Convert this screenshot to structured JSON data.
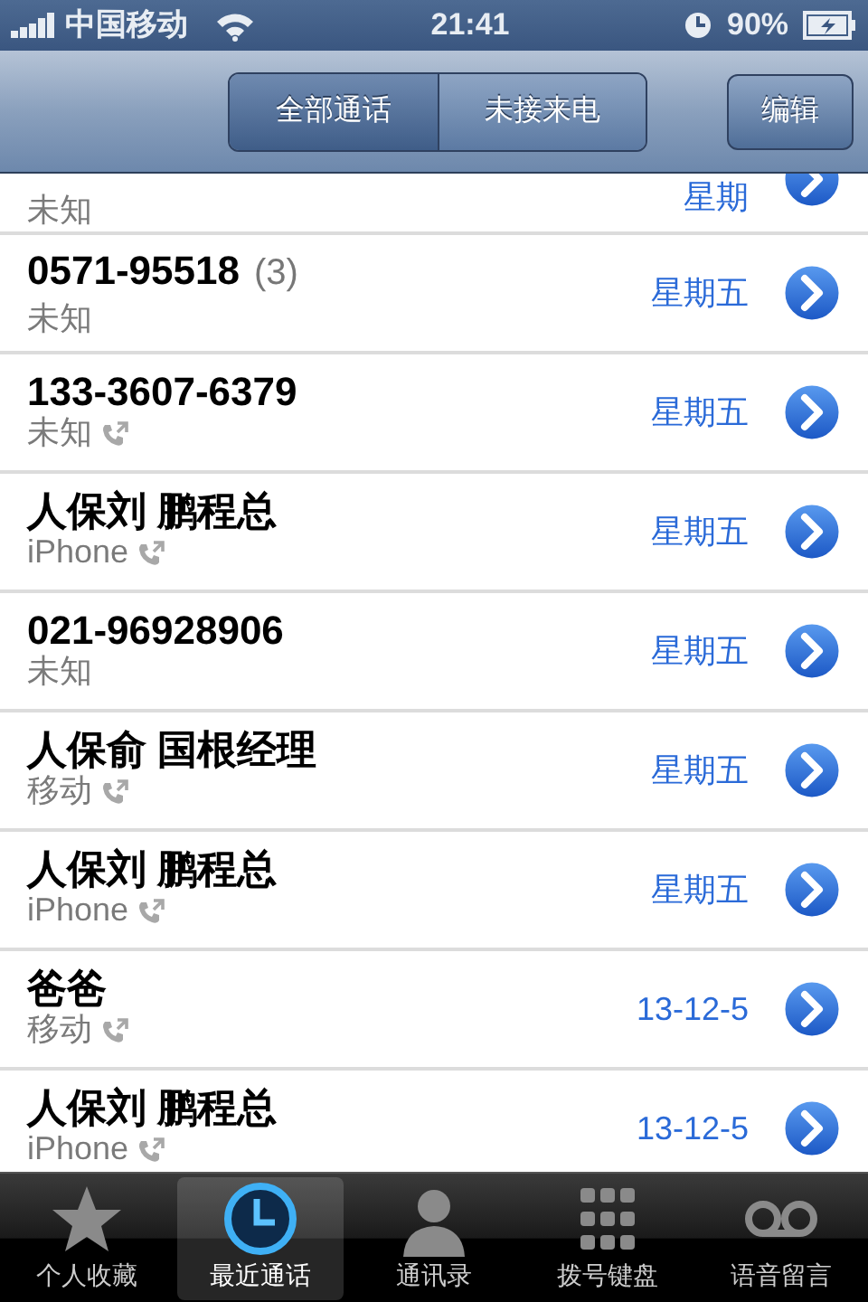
{
  "status_bar": {
    "carrier": "中国移动",
    "time": "21:41",
    "battery": "90%"
  },
  "nav_bar": {
    "segments": [
      {
        "label": "全部通话",
        "selected": true
      },
      {
        "label": "未接来电",
        "selected": false
      }
    ],
    "edit_button": "编辑"
  },
  "calls": [
    {
      "kind": "partial",
      "subtitle": "未知",
      "outgoing": false,
      "date": "星期"
    },
    {
      "kind": "full",
      "name": "0571-95518",
      "count": "(3)",
      "subtitle": "未知",
      "outgoing": false,
      "date": "星期五"
    },
    {
      "kind": "full",
      "name": "133-3607-6379",
      "subtitle": "未知",
      "outgoing": true,
      "date": "星期五"
    },
    {
      "kind": "full",
      "name": "人保刘 鹏程总",
      "subtitle": "iPhone",
      "outgoing": true,
      "date": "星期五"
    },
    {
      "kind": "full",
      "name": "021-96928906",
      "subtitle": "未知",
      "outgoing": false,
      "date": "星期五"
    },
    {
      "kind": "full",
      "name": "人保俞 国根经理",
      "subtitle": "移动",
      "outgoing": true,
      "date": "星期五"
    },
    {
      "kind": "full",
      "name": "人保刘 鹏程总",
      "subtitle": "iPhone",
      "outgoing": true,
      "date": "星期五"
    },
    {
      "kind": "full",
      "name": "爸爸",
      "subtitle": "移动",
      "outgoing": true,
      "date": "13-12-5"
    },
    {
      "kind": "full",
      "name": "人保刘 鹏程总",
      "subtitle": "iPhone",
      "outgoing": true,
      "date": "13-12-5"
    }
  ],
  "tab_bar": [
    {
      "label": "个人收藏",
      "kind": "star",
      "selected": false
    },
    {
      "label": "最近通话",
      "kind": "clock",
      "selected": true
    },
    {
      "label": "通讯录",
      "kind": "person",
      "selected": false
    },
    {
      "label": "拨号键盘",
      "kind": "keypad",
      "selected": false
    },
    {
      "label": "语音留言",
      "kind": "voicemail",
      "selected": false
    }
  ]
}
